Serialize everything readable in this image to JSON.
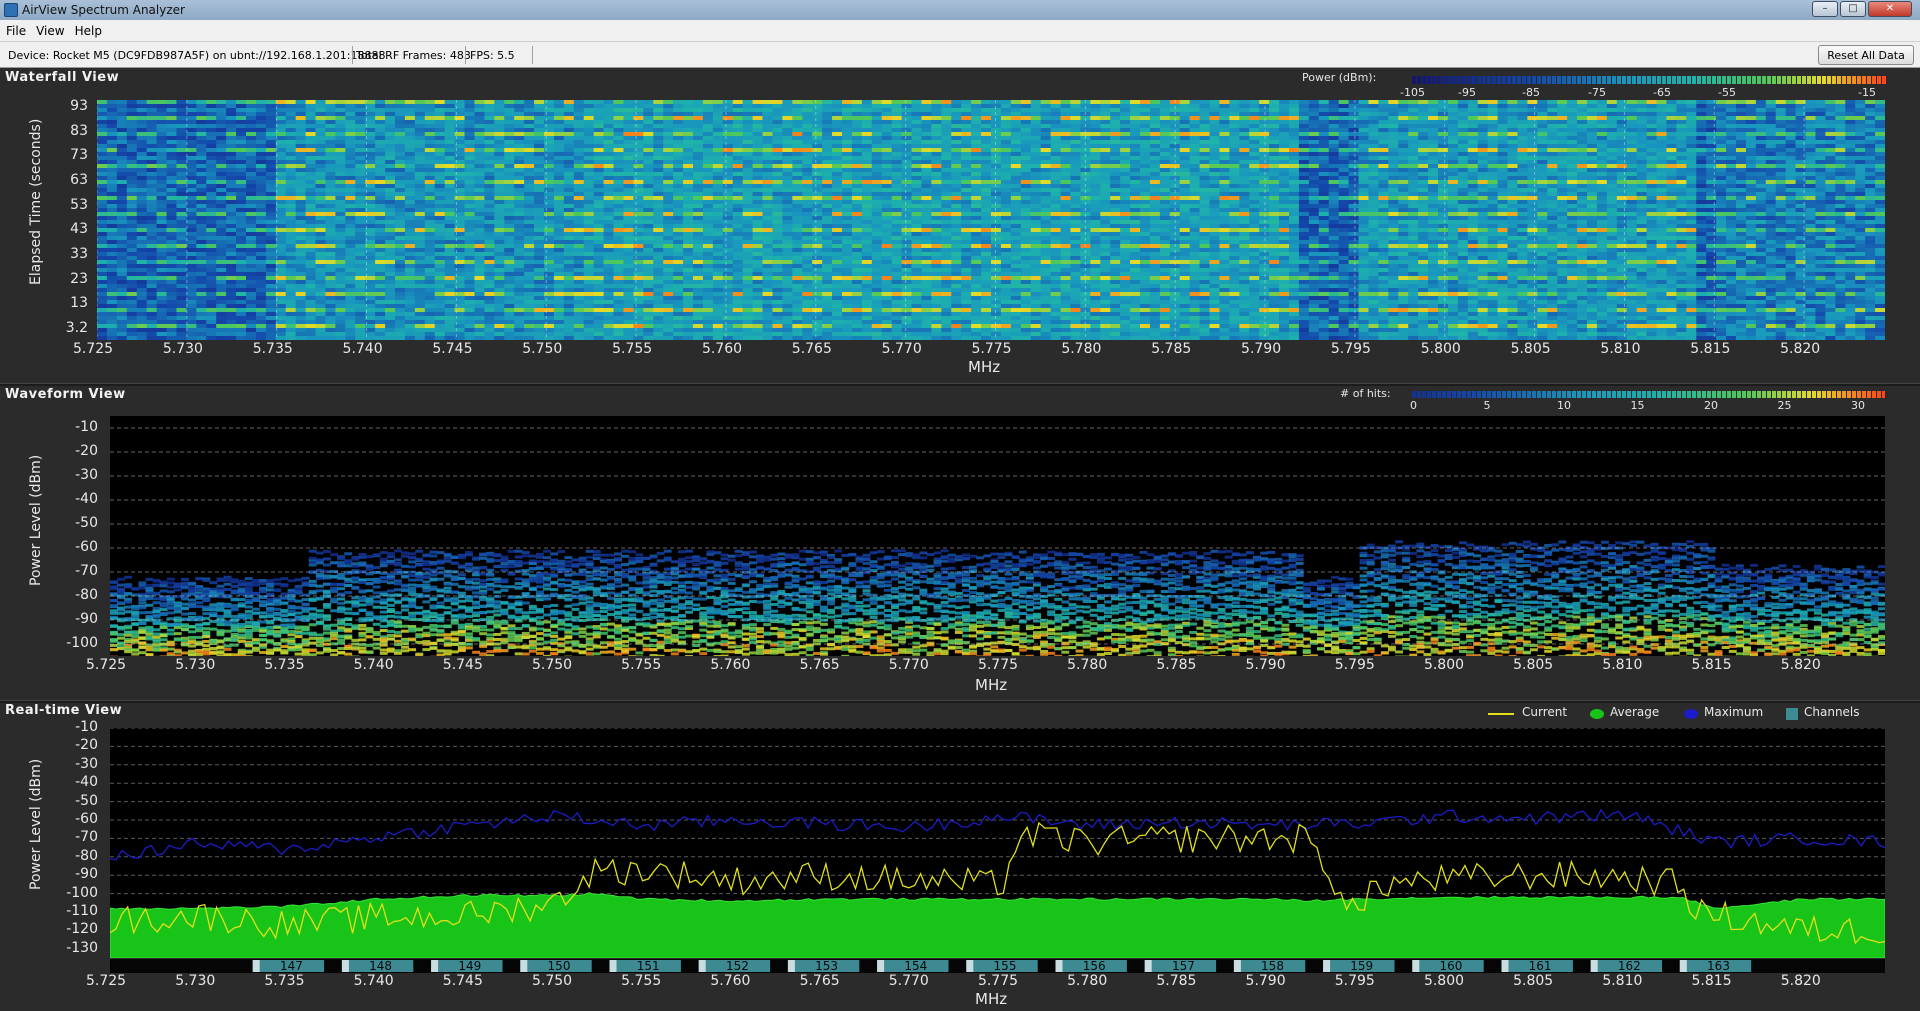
{
  "window": {
    "title": "AirView Spectrum Analyzer"
  },
  "menu": {
    "file": "File",
    "view": "View",
    "help": "Help"
  },
  "status": {
    "device": "Device: Rocket M5 (DC9FDB987A5F) on ubnt://192.168.1.201:18888",
    "frames": "Total RF Frames: 483",
    "fps": "FPS: 5.5",
    "reset_label": "Reset All Data"
  },
  "waterfall": {
    "title": "Waterfall View",
    "legend_label": "Power (dBm):",
    "legend_ticks": [
      "-105",
      "-95",
      "-85",
      "-75",
      "-65",
      "-55",
      "-15"
    ],
    "ylabel": "Elapsed Time (seconds)",
    "yticks": [
      "93",
      "83",
      "73",
      "63",
      "53",
      "43",
      "33",
      "23",
      "13",
      "3.2"
    ],
    "xlabel": "MHz"
  },
  "waveform": {
    "title": "Waveform View",
    "legend_label": "# of hits:",
    "legend_ticks": [
      "0",
      "5",
      "10",
      "15",
      "20",
      "25",
      "30"
    ],
    "ylabel": "Power Level (dBm)",
    "yticks": [
      "-10",
      "-20",
      "-30",
      "-40",
      "-50",
      "-60",
      "-70",
      "-80",
      "-90",
      "-100"
    ],
    "xlabel": "MHz"
  },
  "realtime": {
    "title": "Real-time View",
    "legend": [
      "Current",
      "Average",
      "Maximum",
      "Channels"
    ],
    "ylabel": "Power Level (dBm)",
    "yticks": [
      "-10",
      "-20",
      "-30",
      "-40",
      "-50",
      "-60",
      "-70",
      "-80",
      "-90",
      "-100",
      "-110",
      "-120",
      "-130"
    ],
    "xlabel": "MHz",
    "channels": [
      "147",
      "148",
      "149",
      "150",
      "151",
      "152",
      "153",
      "154",
      "155",
      "156",
      "157",
      "158",
      "159",
      "160",
      "161",
      "162",
      "163"
    ]
  },
  "xticks": [
    "5.725",
    "5.730",
    "5.735",
    "5.740",
    "5.745",
    "5.750",
    "5.755",
    "5.760",
    "5.765",
    "5.770",
    "5.775",
    "5.780",
    "5.785",
    "5.790",
    "5.795",
    "5.800",
    "5.805",
    "5.810",
    "5.815",
    "5.820"
  ],
  "colors": {
    "current": "#e0e01a",
    "average": "#19c419",
    "maximum": "#1c1cc8",
    "channels": "#3d8a92",
    "plot_bg": "#000000"
  },
  "chart_data": {
    "type": "line",
    "title": "Real-time View",
    "xlabel": "MHz",
    "ylabel": "Power Level (dBm)",
    "x_range": [
      5.725,
      5.8245
    ],
    "ylim": [
      -135,
      -10
    ],
    "series": [
      {
        "name": "Maximum",
        "x": [
          5.725,
          5.73,
          5.735,
          5.74,
          5.745,
          5.75,
          5.755,
          5.76,
          5.765,
          5.77,
          5.775,
          5.78,
          5.785,
          5.79,
          5.795,
          5.8,
          5.805,
          5.81,
          5.815,
          5.82,
          5.8245
        ],
        "values": [
          -80,
          -73,
          -76,
          -69,
          -63,
          -58,
          -63,
          -60,
          -62,
          -64,
          -58,
          -63,
          -61,
          -63,
          -62,
          -58,
          -59,
          -57,
          -72,
          -70,
          -72
        ]
      },
      {
        "name": "Current",
        "x": [
          5.725,
          5.73,
          5.735,
          5.74,
          5.745,
          5.75,
          5.752,
          5.755,
          5.76,
          5.765,
          5.77,
          5.775,
          5.776,
          5.78,
          5.785,
          5.79,
          5.792,
          5.795,
          5.796,
          5.8,
          5.805,
          5.81,
          5.813,
          5.814,
          5.82,
          5.8245
        ],
        "values": [
          -115,
          -112,
          -117,
          -113,
          -112,
          -105,
          -88,
          -87,
          -93,
          -90,
          -93,
          -95,
          -68,
          -72,
          -70,
          -70,
          -70,
          -112,
          -95,
          -92,
          -90,
          -91,
          -95,
          -110,
          -120,
          -120
        ]
      },
      {
        "name": "Average",
        "x": [
          5.725,
          5.73,
          5.735,
          5.74,
          5.745,
          5.75,
          5.752,
          5.755,
          5.76,
          5.765,
          5.77,
          5.775,
          5.78,
          5.785,
          5.79,
          5.792,
          5.795,
          5.8,
          5.805,
          5.81,
          5.813,
          5.815,
          5.82,
          5.8245
        ],
        "values": [
          -108,
          -108,
          -107,
          -103,
          -101,
          -101,
          -100,
          -103,
          -104,
          -103,
          -103,
          -103,
          -103,
          -103,
          -103,
          -104,
          -103,
          -102,
          -102,
          -102,
          -102,
          -108,
          -103,
          -103
        ]
      }
    ],
    "channels": [
      "147",
      "148",
      "149",
      "150",
      "151",
      "152",
      "153",
      "154",
      "155",
      "156",
      "157",
      "158",
      "159",
      "160",
      "161",
      "162",
      "163"
    ],
    "legend": "top-right"
  }
}
